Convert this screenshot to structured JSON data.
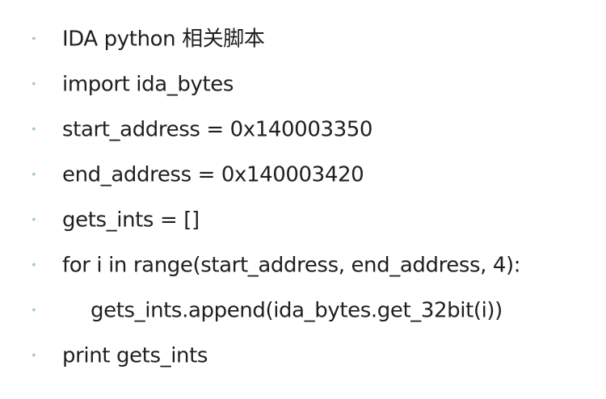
{
  "accent_color": "#9fc7dc",
  "text_color": "#1f1f1f",
  "bullet_symbol": "•",
  "lines": [
    {
      "text": "IDA python 相关脚本",
      "indent": 0
    },
    {
      "text": "import ida_bytes",
      "indent": 0
    },
    {
      "text": "start_address = 0x140003350",
      "indent": 0
    },
    {
      "text": "end_address = 0x140003420",
      "indent": 0
    },
    {
      "text": "gets_ints = []",
      "indent": 0
    },
    {
      "text": "for i in range(start_address, end_address, 4):",
      "indent": 0
    },
    {
      "text": "gets_ints.append(ida_bytes.get_32bit(i))",
      "indent": 1
    },
    {
      "text": "print gets_ints",
      "indent": 0
    }
  ]
}
